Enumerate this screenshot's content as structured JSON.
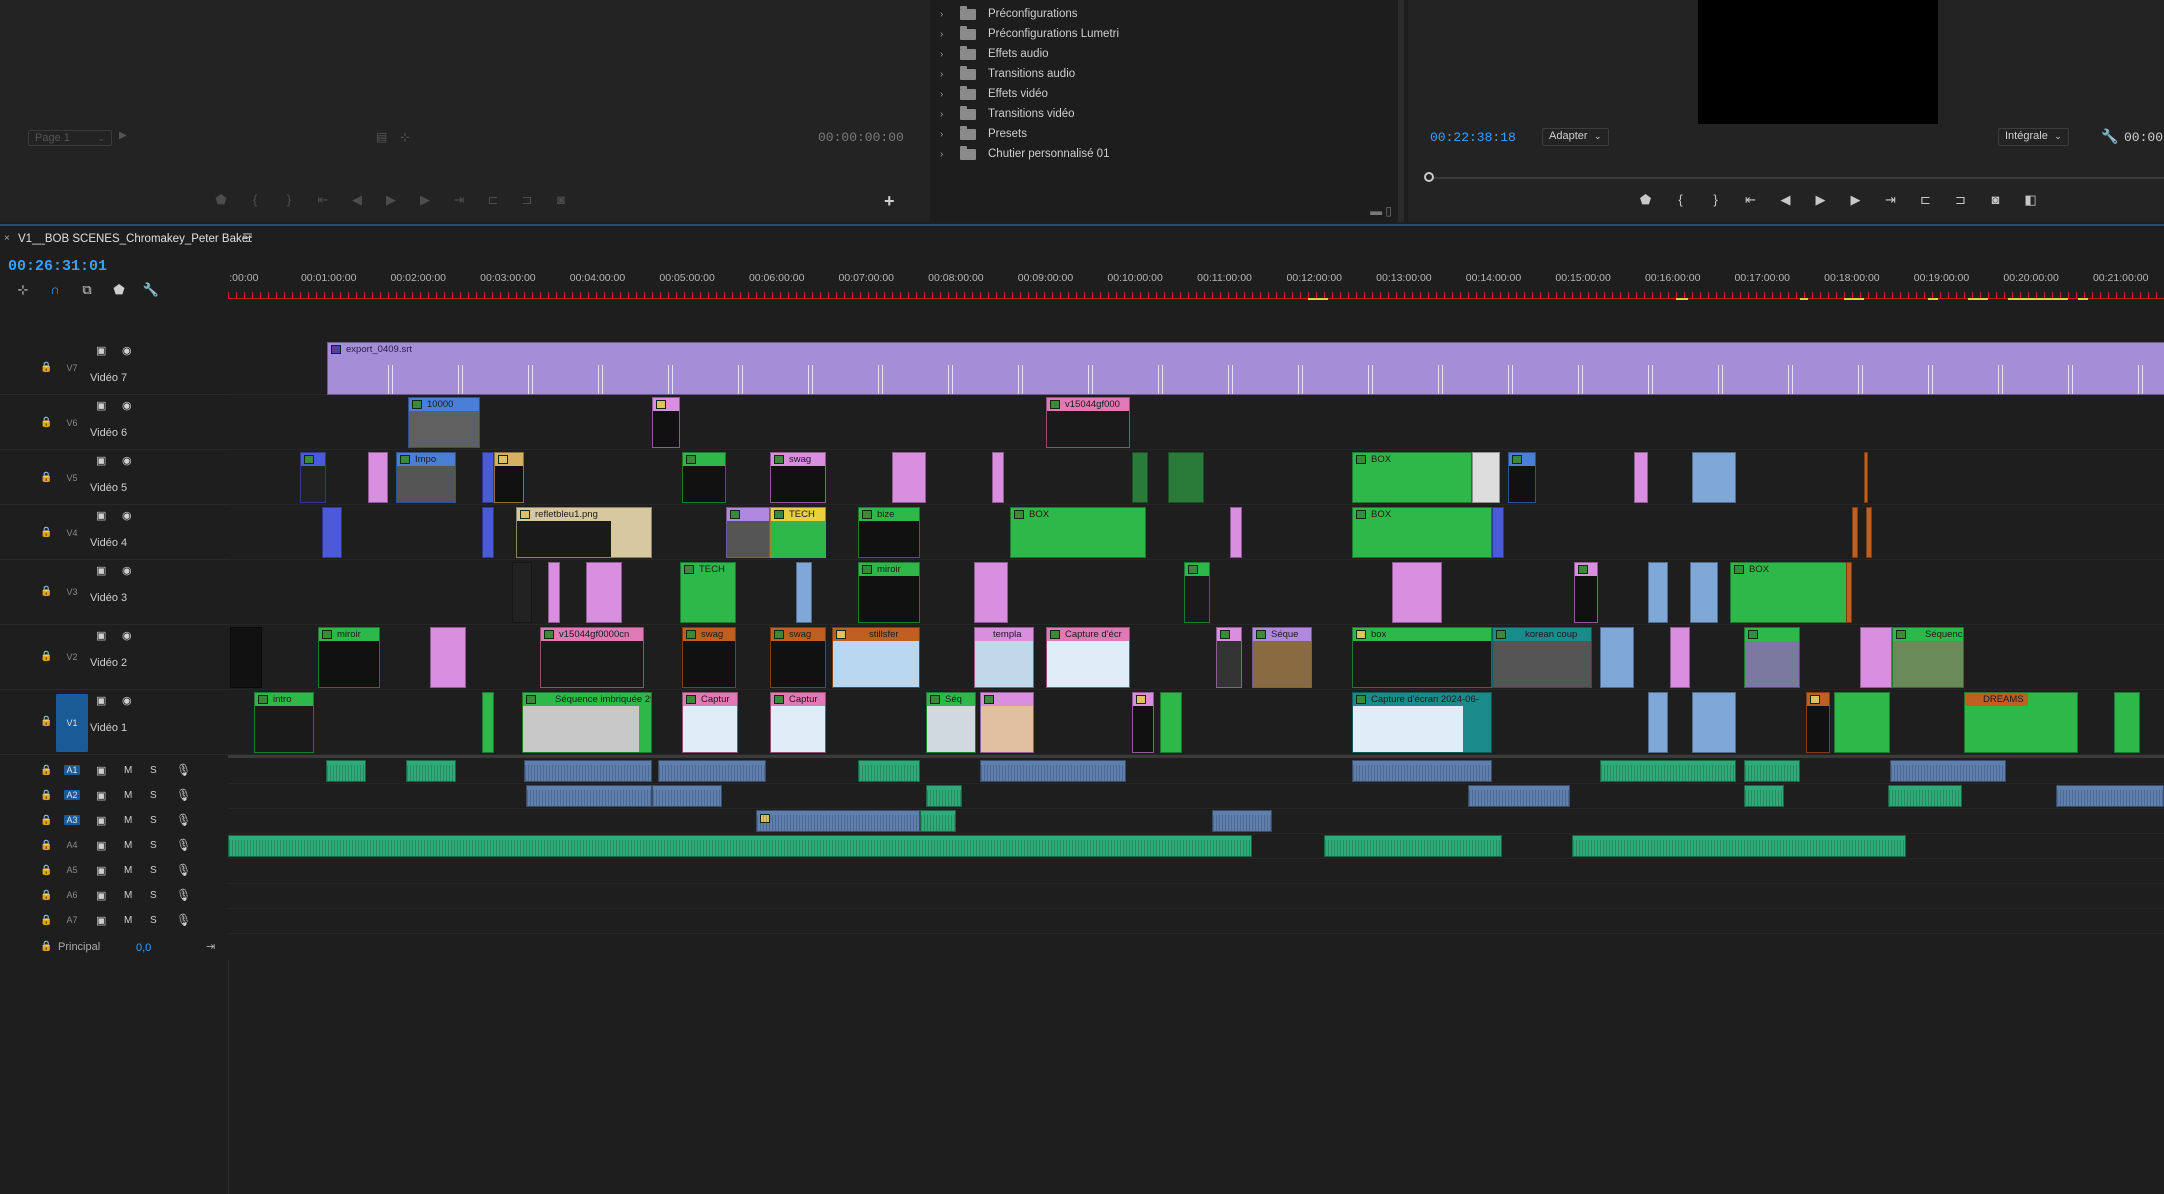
{
  "source": {
    "page_select": "Page 1",
    "timecode": "00:00:00:00"
  },
  "effects": {
    "items": [
      "Préconfigurations",
      "Préconfigurations Lumetri",
      "Effets audio",
      "Transitions audio",
      "Effets vidéo",
      "Transitions vidéo",
      "Presets",
      "Chutier personnalisé 01"
    ]
  },
  "program": {
    "timecode": "00:22:38:18",
    "fit_select": "Adapter",
    "quality_select": "Intégrale",
    "timecode_right": "00:00"
  },
  "timeline": {
    "title": "V1__BOB SCENES_Chromakey_Peter Baker",
    "timecode": "00:26:31:01",
    "ruler_labels": [
      ":00:00",
      "00:01:00:00",
      "00:02:00:00",
      "00:03:00:00",
      "00:04:00:00",
      "00:05:00:00",
      "00:06:00:00",
      "00:07:00:00",
      "00:08:00:00",
      "00:09:00:00",
      "00:10:00:00",
      "00:11:00:00",
      "00:12:00:00",
      "00:13:00:00",
      "00:14:00:00",
      "00:15:00:00",
      "00:16:00:00",
      "00:17:00:00",
      "00:18:00:00",
      "00:19:00:00",
      "00:20:00:00",
      "00:21:00:00"
    ],
    "video_tracks": [
      {
        "id": "V7",
        "name": "Vidéo 7"
      },
      {
        "id": "V6",
        "name": "Vidéo 6"
      },
      {
        "id": "V5",
        "name": "Vidéo 5"
      },
      {
        "id": "V4",
        "name": "Vidéo 4"
      },
      {
        "id": "V3",
        "name": "Vidéo 3"
      },
      {
        "id": "V2",
        "name": "Vidéo 2"
      },
      {
        "id": "V1",
        "name": "Vidéo 1"
      }
    ],
    "audio_tracks": [
      {
        "id": "A1"
      },
      {
        "id": "A2"
      },
      {
        "id": "A3"
      },
      {
        "id": "A4"
      },
      {
        "id": "A5"
      },
      {
        "id": "A6"
      },
      {
        "id": "A7"
      }
    ],
    "audio_buttons": {
      "mute": "M",
      "solo": "S"
    },
    "master": {
      "label": "Principal",
      "value": "0,0"
    },
    "clip_labels": {
      "subtitles": "export_0409.srt",
      "v6_a": "10000",
      "v6_b": "v15044gf000",
      "v5_a": "Impo",
      "v5_b": "swag",
      "v5_c": "BOX",
      "v4_a": "refletbleu1.png",
      "v4_b": "TECH",
      "v4_c": "bize",
      "v4_d": "BOX",
      "v4_e": "BOX",
      "v3_a": "TECH",
      "v3_b": "miroir",
      "v3_c": "BOX",
      "v2_a": "miroir",
      "v2_b": "v15044gf0000cn",
      "v2_c": "swag",
      "v2_d": "swag",
      "v2_e": "stillsfer",
      "v2_f": "templa",
      "v2_g": "Capture d'écr",
      "v2_h": "Séque",
      "v2_i": "box",
      "v2_j": "korean coup",
      "v2_k": "Séquence",
      "v1_a": "intro",
      "v1_b": "Séquence imbriquée 29",
      "v1_c": "Captur",
      "v1_d": "Captur",
      "v1_e": "Séq",
      "v1_f": "Capture d'écran 2024-06-",
      "v1_g": "DREAMS"
    }
  },
  "colors": {
    "accent_blue": "#39a0ff",
    "subtitle_clip": "#a58ed6",
    "green_clip": "#2fb84a",
    "pink_clip": "#d98ee0",
    "audio_green": "#2faa78",
    "audio_blue": "#5f7fae"
  }
}
